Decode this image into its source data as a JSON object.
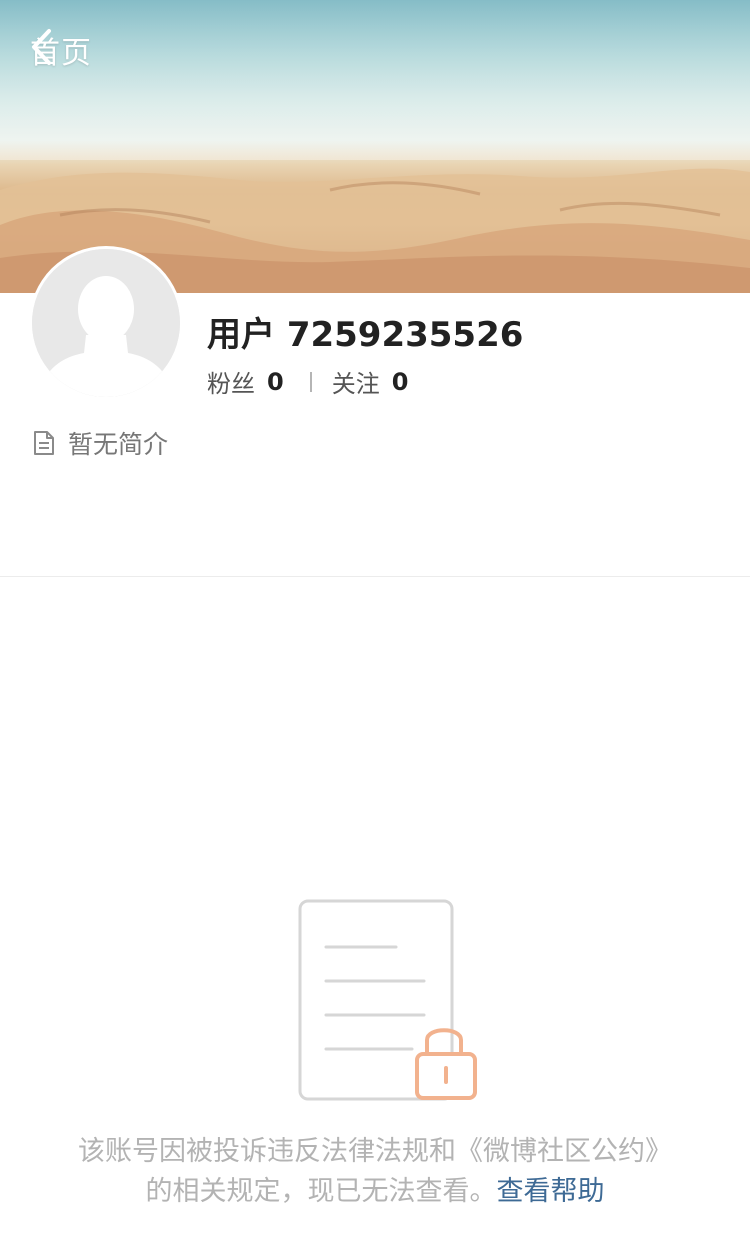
{
  "nav": {
    "back_label": "首页"
  },
  "profile": {
    "username": "用户 7259235526",
    "followers_label": "粉丝",
    "followers_count": "0",
    "following_label": "关注",
    "following_count": "0",
    "bio": "暂无简介"
  },
  "notice": {
    "message": "该账号因被投诉违反法律法规和《微博社区公约》的相关规定，现已无法查看。",
    "help_link": "查看帮助"
  },
  "colors": {
    "link": "#3e6a95",
    "lock": "#f2b28e",
    "notice_text": "#b3b3b3"
  }
}
